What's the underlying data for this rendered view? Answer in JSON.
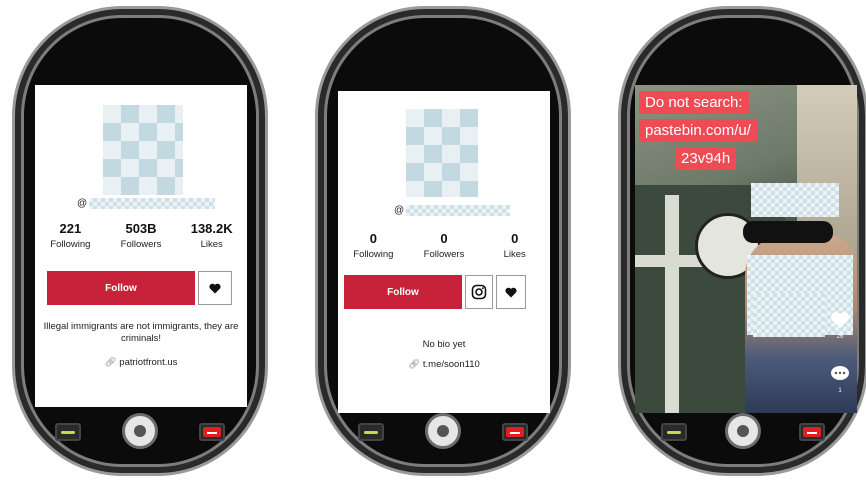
{
  "phones": [
    {
      "handle_prefix": "@",
      "stats": [
        {
          "value": "221",
          "label": "Following"
        },
        {
          "value": "503B",
          "label": "Followers"
        },
        {
          "value": "138.2K",
          "label": "Likes"
        }
      ],
      "follow_label": "Follow",
      "bio": "Illegal immigrants are not immigrants, they are criminals!",
      "link": "patriotfront.us"
    },
    {
      "handle_prefix": "@",
      "stats": [
        {
          "value": "0",
          "label": "Following"
        },
        {
          "value": "0",
          "label": "Followers"
        },
        {
          "value": "0",
          "label": "Likes"
        }
      ],
      "follow_label": "Follow",
      "bio": "No bio yet",
      "link": "t.me/soon110"
    },
    {
      "overlay_lines": [
        "Do not search:",
        "pastebin.com/u/",
        "23v94h"
      ],
      "side_counts": [
        "26",
        "1"
      ]
    }
  ],
  "colors": {
    "follow": "#c8223a",
    "overlay_tag": "#ef4b55"
  },
  "icons": [
    "heart-icon",
    "instagram-icon",
    "link-icon",
    "comment-icon"
  ]
}
